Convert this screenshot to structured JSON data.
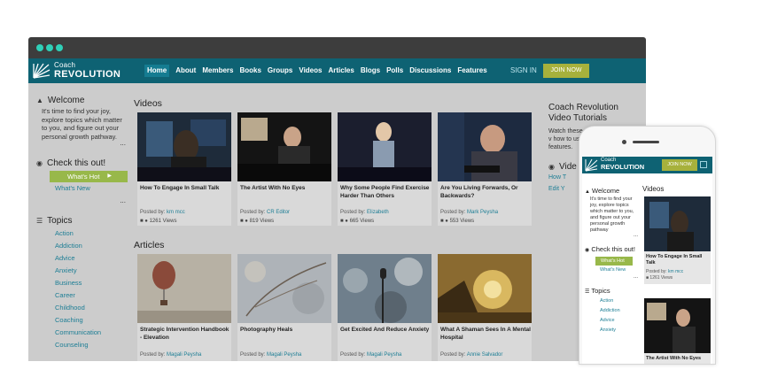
{
  "logo": {
    "line1": "Coach",
    "line2": "REVOLUTION"
  },
  "nav": {
    "items": [
      "Home",
      "About",
      "Members",
      "Books",
      "Groups",
      "Videos",
      "Articles",
      "Blogs",
      "Polls",
      "Discussions",
      "Features"
    ],
    "signin": "SIGN IN",
    "join": "JOIN NOW"
  },
  "sidebar": {
    "welcome_title": "Welcome",
    "welcome_text": "It's time to find your joy, explore topics which matter to you, and figure out your personal growth pathway.",
    "more": "...",
    "check_title": "Check this out!",
    "whats_hot": "What's Hot",
    "whats_new": "What's New",
    "topics_title": "Topics",
    "topics": [
      "Action",
      "Addiction",
      "Advice",
      "Anxiety",
      "Business",
      "Career",
      "Childhood",
      "Coaching",
      "Communication",
      "Counseling"
    ]
  },
  "videos": {
    "heading": "Videos",
    "posted_label": "Posted by:",
    "items": [
      {
        "title": "How To Engage In Small Talk",
        "author": "km mcc",
        "views": "1261 Views"
      },
      {
        "title": "The Artist With No Eyes",
        "author": "CR Editor",
        "views": "819 Views"
      },
      {
        "title": "Why Some People Find Exercise Harder Than Others",
        "author": "Elizabeth",
        "views": "665 Views"
      },
      {
        "title": "Are You Living Forwards, Or Backwards?",
        "author": "Mark Peysha",
        "views": "553 Views"
      }
    ]
  },
  "articles": {
    "heading": "Articles",
    "posted_label": "Posted by:",
    "items": [
      {
        "title": "Strategic Intervention Handbook - Elevation",
        "author": "Magali Peysha"
      },
      {
        "title": "Photography Heals",
        "author": "Magali Peysha"
      },
      {
        "title": "Get Excited And Reduce Anxiety",
        "author": "Magali Peysha"
      },
      {
        "title": "What A Shaman Sees In A Mental Hospital",
        "author": "Annie Salvador"
      }
    ]
  },
  "right": {
    "title1": "Coach Revolution",
    "title2": "Video Tutorials",
    "text": "Watch these v how to use features.",
    "title3": "Vide",
    "links": [
      "How T",
      "Edit Y"
    ]
  },
  "phone": {
    "logo1": "Coach",
    "logo2": "REVOLUTION",
    "join": "JOIN NOW",
    "welcome_title": "Welcome",
    "welcome_text": "It's time to find your joy, explore topics which matter to you, and figure out your personal growth pathway",
    "more": "...",
    "check_title": "Check this out!",
    "whats_hot": "What's Hot",
    "whats_new": "What's New",
    "topics_title": "Topics",
    "topics": [
      "Action",
      "Addiction",
      "Advice",
      "Anxiety"
    ],
    "videos_heading": "Videos",
    "card1_title": "How To Engage In Small Talk",
    "card1_posted": "Posted by:",
    "card1_author": "km mcc",
    "card1_views": "1261 Views",
    "card2_title": "The Artist With No Eyes"
  },
  "colors": {
    "nav": "#0e6273",
    "accent": "#a7b13c",
    "pill": "#98b84a",
    "link": "#1d7e95",
    "dots": "#2fd0b8"
  }
}
